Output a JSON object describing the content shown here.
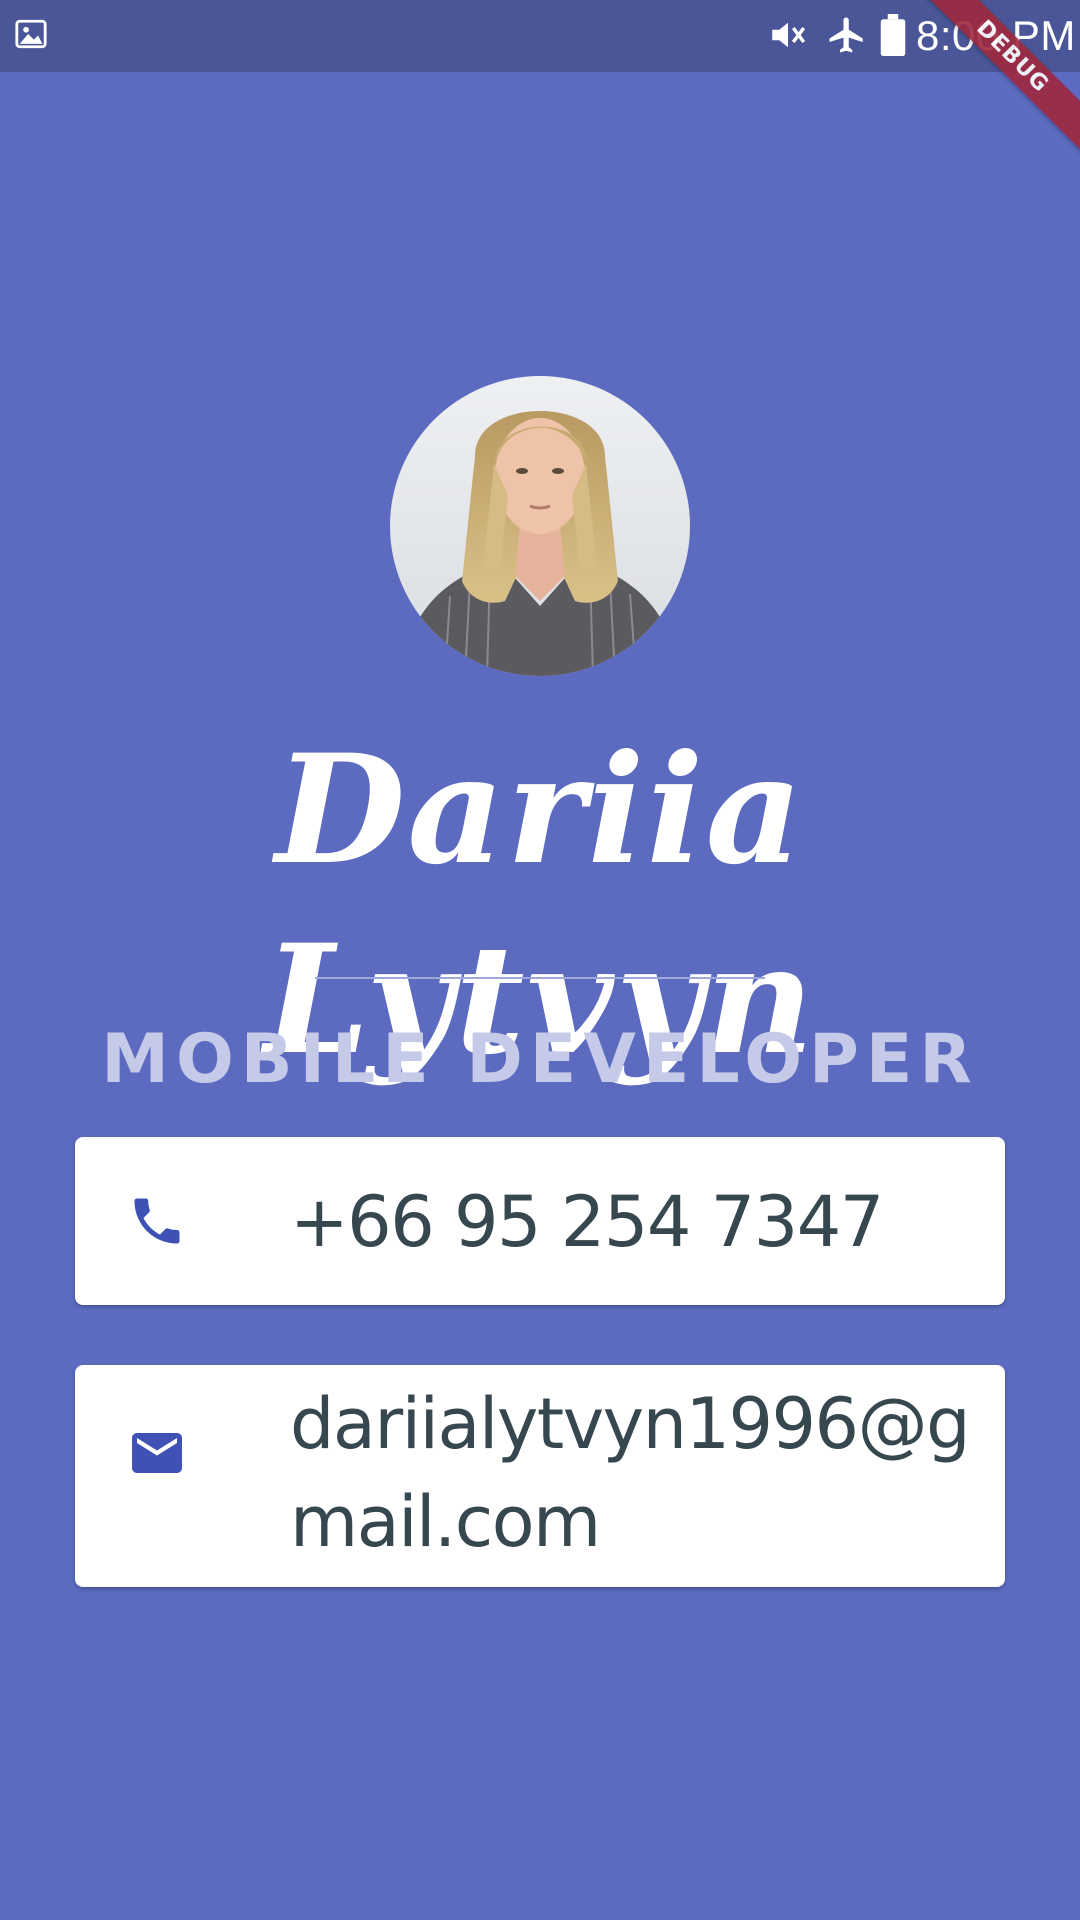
{
  "status_bar": {
    "time": "8:00 PM",
    "icons": [
      "gallery-icon",
      "mute-icon",
      "airplane-mode-icon",
      "battery-icon"
    ]
  },
  "debug_banner": {
    "label": "DEBUG",
    "color": "#a0283e"
  },
  "profile": {
    "name": "Dariia Lytvyn",
    "title": "MOBILE DEVELOPER",
    "avatar_alt": "profile photo"
  },
  "contacts": {
    "phone": {
      "icon": "phone-icon",
      "value": "+66 95 254 7347"
    },
    "email": {
      "icon": "email-icon",
      "value": "dariialytvyn1996@gmail.com"
    }
  },
  "colors": {
    "background": "#5c6bc0",
    "status_bar": "#4a5697",
    "card": "#ffffff",
    "card_text": "#37474f",
    "icon": "#3f51b5",
    "subtitle": "#c5cae9"
  }
}
